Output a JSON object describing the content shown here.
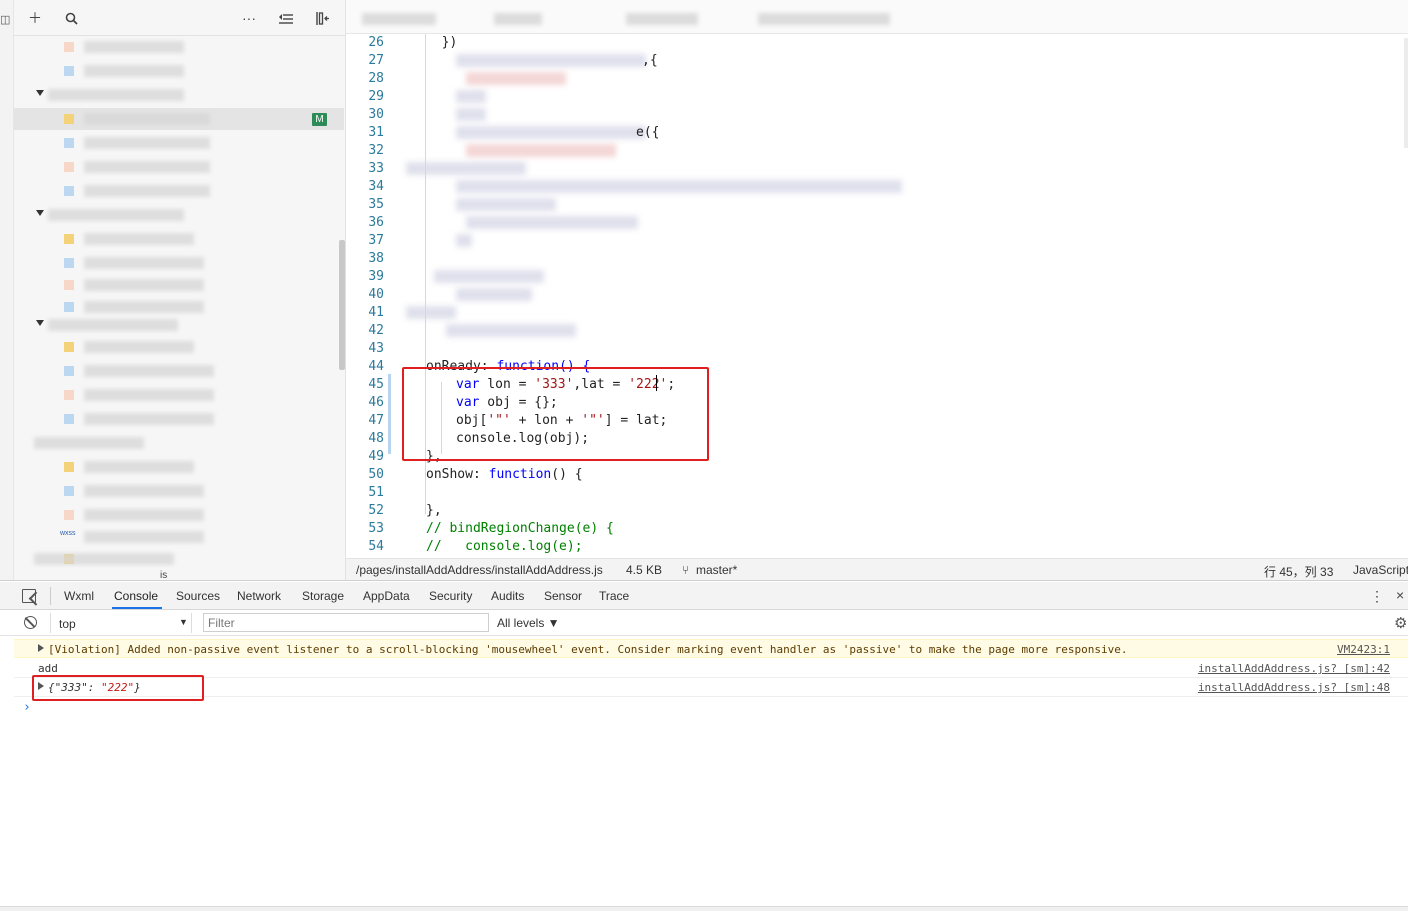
{
  "sidebar": {
    "add_icon": "plus-icon",
    "search_icon": "search-icon",
    "more_icon": "more-icon",
    "collapse_icon": "collapse-icon",
    "layout_icon": "layout-icon",
    "badge": "M",
    "fragments": [
      "wxss",
      "is"
    ]
  },
  "editor": {
    "lines": [
      {
        "n": "26",
        "code": "  })"
      },
      {
        "n": "27",
        "code": ""
      },
      {
        "n": "28",
        "code": ""
      },
      {
        "n": "29",
        "code": ""
      },
      {
        "n": "30",
        "code": ""
      },
      {
        "n": "31",
        "code": ""
      },
      {
        "n": "32",
        "code": ""
      },
      {
        "n": "33",
        "code": ""
      },
      {
        "n": "34",
        "code": ""
      },
      {
        "n": "35",
        "code": ""
      },
      {
        "n": "36",
        "code": ""
      },
      {
        "n": "37",
        "code": ""
      },
      {
        "n": "38",
        "code": ""
      },
      {
        "n": "39",
        "code": ""
      },
      {
        "n": "40",
        "code": ""
      },
      {
        "n": "41",
        "code": ""
      },
      {
        "n": "42",
        "code": ""
      },
      {
        "n": "43",
        "code": ""
      },
      {
        "n": "44",
        "code": ""
      },
      {
        "n": "45",
        "code": ""
      },
      {
        "n": "46",
        "code": ""
      },
      {
        "n": "47",
        "code": ""
      },
      {
        "n": "48",
        "code": ""
      },
      {
        "n": "49",
        "code": "},"
      },
      {
        "n": "50",
        "code": ""
      },
      {
        "n": "51",
        "code": ""
      },
      {
        "n": "52",
        "code": "},"
      },
      {
        "n": "53",
        "code": ""
      },
      {
        "n": "54",
        "code": ""
      }
    ],
    "fragments": {
      "l27": ",{",
      "l31": "e({",
      "l44a": "onReady: ",
      "l44b": "function() {",
      "l45_kw": "var",
      "l45_a": " lon = ",
      "l45_s1": "'333'",
      "l45_b": ",lat = ",
      "l45_s2": "'222'",
      "l45_c": ";",
      "l46_kw": "var",
      "l46_a": " obj = {};",
      "l47_a": "obj[",
      "l47_s1": "'\"'",
      "l47_b": " + lon + ",
      "l47_s2": "'\"'",
      "l47_c": "] = lat;",
      "l48": "console.log(obj);",
      "l50_a": "onShow: ",
      "l50_kw": "function",
      "l50_b": "() {",
      "l53": "// bindRegionChange(e) {",
      "l54": "//   console.log(e);"
    }
  },
  "statusbar": {
    "path": "/pages/installAddAddress/installAddAddress.js",
    "size": "4.5 KB",
    "branch": "master*",
    "branch_icon": "git-branch-icon",
    "position": "行 45，列 33",
    "language": "JavaScript"
  },
  "devtools": {
    "tabs": [
      "Wxml",
      "Console",
      "Sources",
      "Network",
      "Storage",
      "AppData",
      "Security",
      "Audits",
      "Sensor",
      "Trace"
    ],
    "active_tab": "Console",
    "context": "top",
    "filter_placeholder": "Filter",
    "levels": "All levels ▼",
    "messages": [
      {
        "text": "[Violation] Added non-passive event listener to a scroll-blocking 'mousewheel' event. Consider marking event handler as 'passive' to make the page more responsive.",
        "source": "VM2423:1",
        "level": "warning"
      },
      {
        "text": "add",
        "source": "installAddAddress.js? [sm]:42",
        "level": "log"
      },
      {
        "text_key": "\"333\"",
        "text_val": "\"222\"",
        "source": "installAddAddress.js? [sm]:48",
        "level": "log"
      }
    ],
    "prompt": "›"
  },
  "colors": {
    "highlight_box": "#e02020",
    "keyword": "#0000ff",
    "string": "#a31515",
    "comment": "#008000",
    "line_number": "#2b7a9b"
  }
}
